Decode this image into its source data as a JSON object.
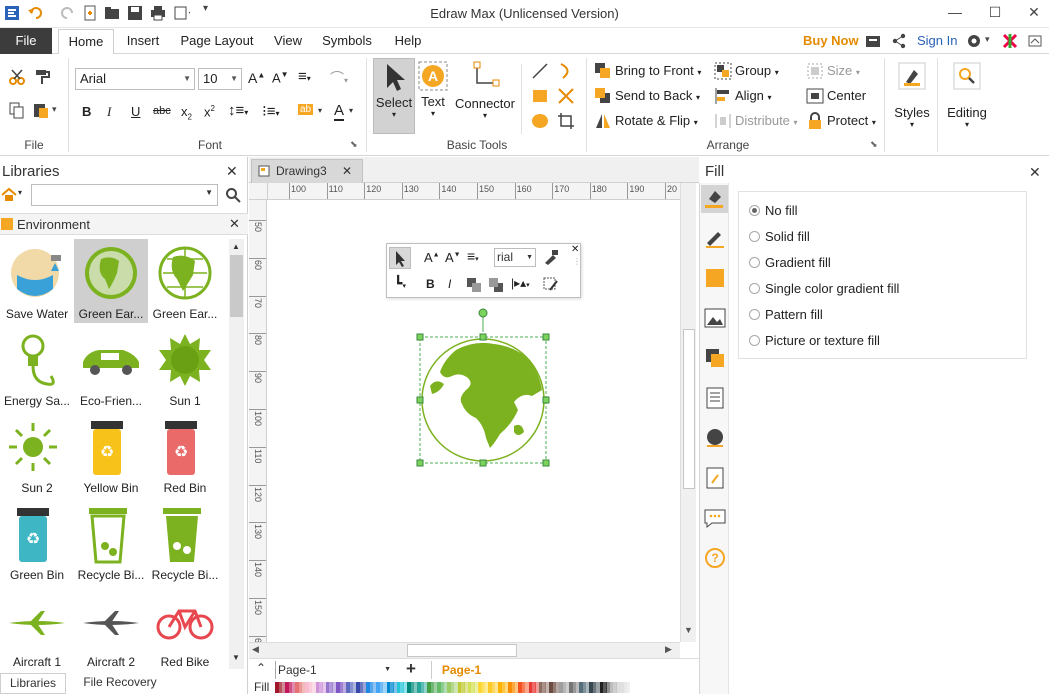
{
  "window": {
    "title": "Edraw Max (Unlicensed Version)"
  },
  "menu": {
    "file": "File",
    "tabs": [
      "Home",
      "Insert",
      "Page Layout",
      "View",
      "Symbols",
      "Help"
    ],
    "buy_now": "Buy Now",
    "sign_in": "Sign In"
  },
  "ribbon": {
    "groups": {
      "file": "File",
      "font": "Font",
      "basic_tools": "Basic Tools",
      "arrange": "Arrange"
    },
    "font_name": "Arial",
    "font_size": "10",
    "tools": {
      "select": "Select",
      "text": "Text",
      "connector": "Connector"
    },
    "arrange": {
      "bring_to_front": "Bring to Front",
      "send_to_back": "Send to Back",
      "rotate_flip": "Rotate & Flip",
      "group": "Group",
      "align": "Align",
      "distribute": "Distribute",
      "size": "Size",
      "center": "Center",
      "protect": "Protect"
    },
    "styles": "Styles",
    "editing": "Editing"
  },
  "libraries": {
    "title": "Libraries",
    "category": "Environment",
    "items": [
      {
        "label": "Save Water"
      },
      {
        "label": "Green Ear..."
      },
      {
        "label": "Green Ear..."
      },
      {
        "label": "Energy Sa..."
      },
      {
        "label": "Eco-Frien..."
      },
      {
        "label": "Sun 1"
      },
      {
        "label": "Sun 2"
      },
      {
        "label": "Yellow Bin"
      },
      {
        "label": "Red Bin"
      },
      {
        "label": "Green Bin"
      },
      {
        "label": "Recycle Bi..."
      },
      {
        "label": "Recycle Bi..."
      },
      {
        "label": "Aircraft 1"
      },
      {
        "label": "Aircraft 2"
      },
      {
        "label": "Red Bike"
      }
    ],
    "bottom_tabs": [
      "Libraries",
      "File Recovery"
    ]
  },
  "document": {
    "tab": "Drawing3",
    "hruler": [
      "100",
      "110",
      "120",
      "130",
      "140",
      "150",
      "160",
      "170",
      "180",
      "190",
      "20"
    ],
    "vruler": [
      "50",
      "60",
      "70",
      "80",
      "90",
      "100",
      "110",
      "120",
      "130",
      "140",
      "150",
      "60"
    ],
    "float_font": "rial",
    "page_select": "Page-1",
    "page_tab": "Page-1",
    "fill_label": "Fill"
  },
  "fill_panel": {
    "title": "Fill",
    "options": [
      {
        "label": "No fill",
        "checked": true
      },
      {
        "label": "Solid fill",
        "checked": false
      },
      {
        "label": "Gradient fill",
        "checked": false
      },
      {
        "label": "Single color gradient fill",
        "checked": false
      },
      {
        "label": "Pattern fill",
        "checked": false
      },
      {
        "label": "Picture or texture fill",
        "checked": false
      }
    ]
  },
  "colors": {
    "accent_orange": "#f5a623",
    "earth_green": "#7cb21f",
    "title_dark": "#3c3c3c"
  }
}
